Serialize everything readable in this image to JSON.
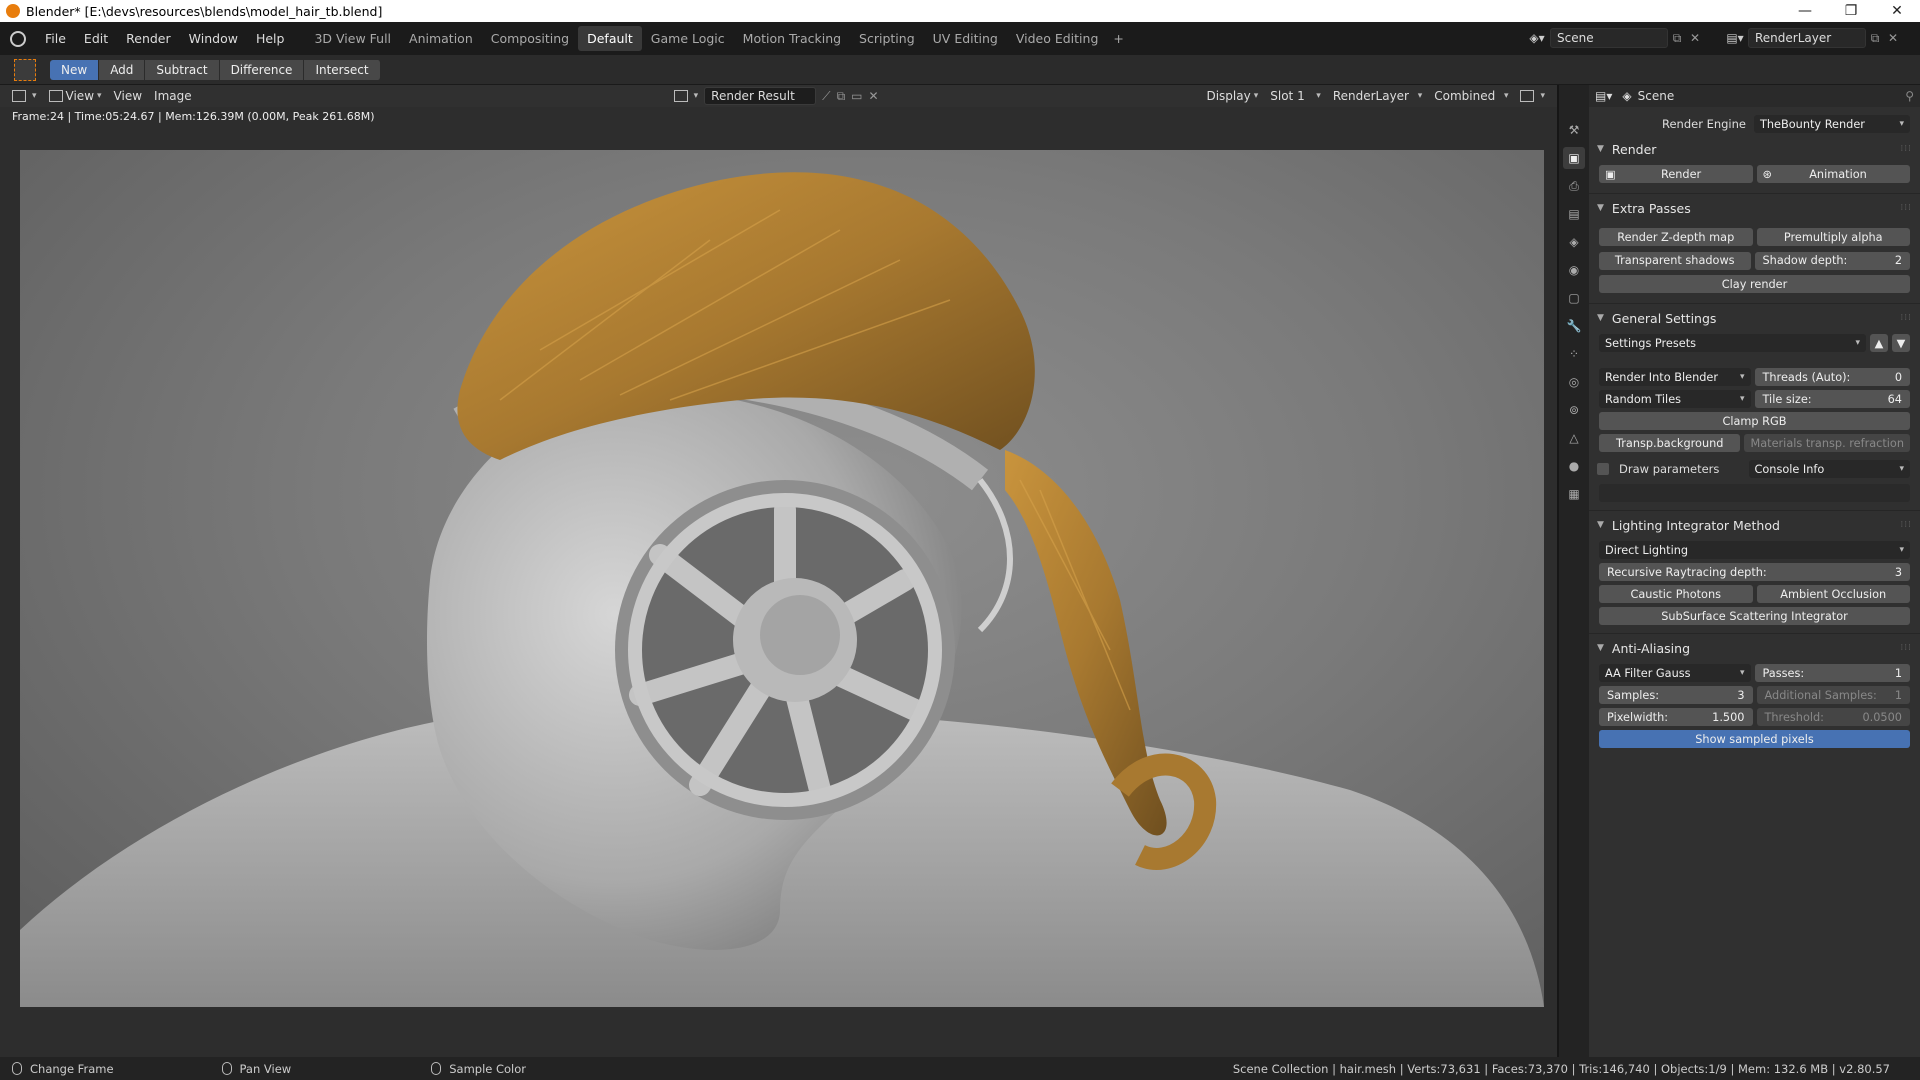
{
  "window": {
    "title": "Blender* [E:\\devs\\resources\\blends\\model_hair_tb.blend]",
    "controls": [
      "—",
      "❐",
      "✕"
    ]
  },
  "menu": [
    "File",
    "Edit",
    "Render",
    "Window",
    "Help"
  ],
  "workspaces": [
    "3D View Full",
    "Animation",
    "Compositing",
    "Default",
    "Game Logic",
    "Motion Tracking",
    "Scripting",
    "UV Editing",
    "Video Editing"
  ],
  "active_workspace": "Default",
  "scene_field": "Scene",
  "view_layer_field": "RenderLayer",
  "toolbar_modes": [
    "New",
    "Add",
    "Subtract",
    "Difference",
    "Intersect"
  ],
  "image_header": {
    "view1": "View",
    "view2": "View",
    "image": "Image",
    "image_name": "Render Result",
    "display": "Display",
    "slot": "Slot 1",
    "layer": "RenderLayer",
    "pass": "Combined"
  },
  "render_status": "Frame:24 | Time:05:24.67 | Mem:126.39M (0.00M, Peak 261.68M)",
  "properties": {
    "header": "Scene",
    "render_engine_label": "Render Engine",
    "render_engine": "TheBounty Render",
    "render": {
      "title": "Render",
      "render_btn": "Render",
      "animation_btn": "Animation"
    },
    "extra_passes": {
      "title": "Extra Passes",
      "zdepth": "Render Z-depth map",
      "premultiply": "Premultiply alpha",
      "transparent_shadows": "Transparent shadows",
      "shadow_depth_label": "Shadow depth:",
      "shadow_depth": "2",
      "clay": "Clay render"
    },
    "general": {
      "title": "General Settings",
      "presets": "Settings Presets",
      "render_into": "Render Into Blender",
      "threads_label": "Threads (Auto):",
      "threads": "0",
      "tiles": "Random Tiles",
      "tile_size_label": "Tile size:",
      "tile_size": "64",
      "clamp": "Clamp RGB",
      "transp_bg": "Transp.background",
      "mat_transp": "Materials transp. refraction",
      "draw_params": "Draw parameters",
      "console": "Console Info"
    },
    "lighting": {
      "title": "Lighting Integrator Method",
      "method": "Direct Lighting",
      "raydepth_label": "Recursive Raytracing depth:",
      "raydepth": "3",
      "caustic": "Caustic Photons",
      "ao": "Ambient Occlusion",
      "sss": "SubSurface Scattering Integrator"
    },
    "aa": {
      "title": "Anti-Aliasing",
      "filter": "AA Filter Gauss",
      "passes_label": "Passes:",
      "passes": "1",
      "samples_label": "Samples:",
      "samples": "3",
      "add_samples_label": "Additional Samples:",
      "add_samples": "1",
      "pixelwidth_label": "Pixelwidth:",
      "pixelwidth": "1.500",
      "threshold_label": "Threshold:",
      "threshold": "0.0500",
      "show_pixels": "Show sampled pixels"
    }
  },
  "statusbar": {
    "change_frame": "Change Frame",
    "pan_view": "Pan View",
    "sample_color": "Sample Color",
    "info": "Scene Collection | hair.mesh | Verts:73,631 | Faces:73,370 | Tris:146,740 | Objects:1/9 | Mem: 132.6 MB | v2.80.57"
  },
  "colors": {
    "accent": "#4772b3",
    "hair": "#a87930",
    "orange": "#e87d0d"
  }
}
